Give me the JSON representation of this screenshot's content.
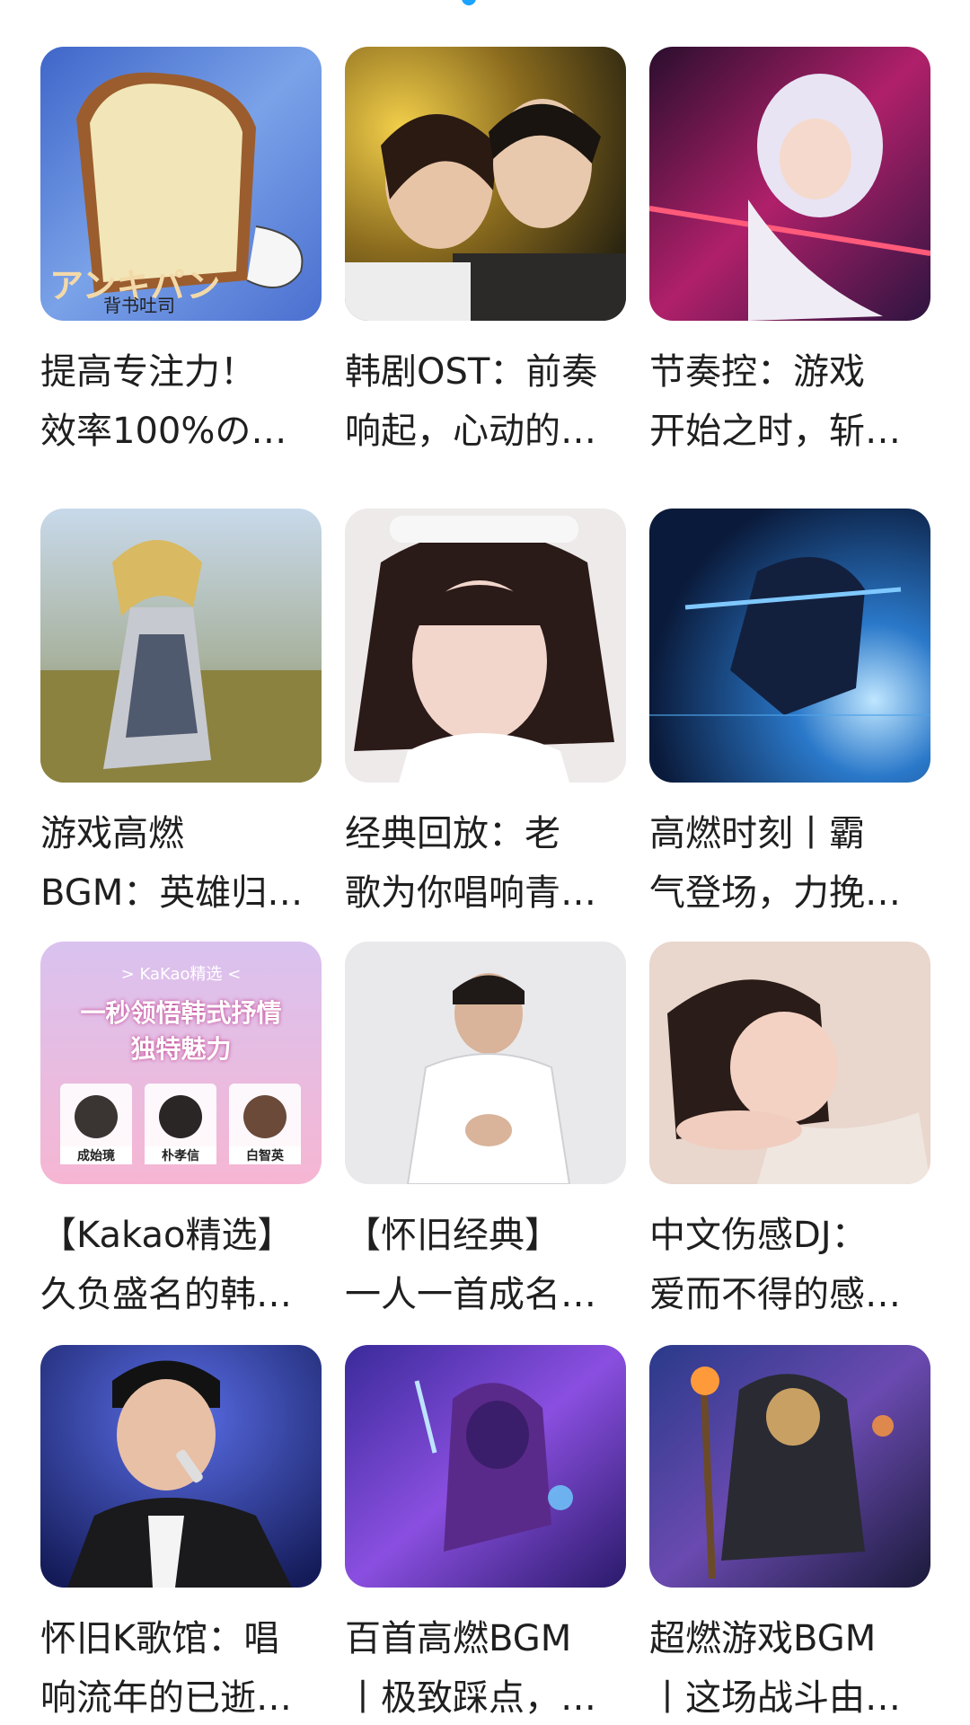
{
  "colors": {
    "scroll_indicator": "#1aa3ff",
    "title_text": "#1f1f1f"
  },
  "cards": [
    {
      "line1": "提高专注力！",
      "line2": "效率100%の…",
      "thumb": "cartoon-bread-art",
      "art_text": "アンキパン",
      "art_subtext": "背书吐司"
    },
    {
      "line1": "韩剧OST：前奏",
      "line2": "响起，心动的…",
      "thumb": "drama-couple-photo"
    },
    {
      "line1": "节奏控：游戏",
      "line2": "开始之时，斩…",
      "thumb": "anime-swordgirl-art"
    },
    {
      "line1": "游戏高燃",
      "line2": "BGM：英雄归…",
      "thumb": "armored-girl-field-art"
    },
    {
      "line1": "经典回放：老",
      "line2": "歌为你唱响青…",
      "thumb": "retro-singer-photo"
    },
    {
      "line1": "高燃时刻丨霸",
      "line2": "气登场，力挽…",
      "thumb": "ninja-blue-art"
    },
    {
      "line1": "【Kakao精选】",
      "line2": "久负盛名的韩…",
      "thumb": "kakao-promo-banner",
      "promo": {
        "tag": "> KaKao精选 <",
        "headline1": "一秒领悟韩式抒情",
        "headline2": "独特魅力",
        "names": [
          "成始璄",
          "朴孝信",
          "白智英"
        ]
      }
    },
    {
      "line1": "【怀旧经典】",
      "line2": "一人一首成名…",
      "thumb": "male-singer-white-suit-photo"
    },
    {
      "line1": "中文伤感DJ：",
      "line2": "爱而不得的感…",
      "thumb": "woman-portrait-photo"
    },
    {
      "line1": "怀旧K歌馆：唱",
      "line2": "响流年的已逝…",
      "thumb": "singer-microphone-photo"
    },
    {
      "line1": "百首高燃BGM",
      "line2": "丨极致踩点，…",
      "thumb": "purple-warrior-art"
    },
    {
      "line1": "超燃游戏BGM",
      "line2": "丨这场战斗由…",
      "thumb": "game-hero-art"
    }
  ]
}
